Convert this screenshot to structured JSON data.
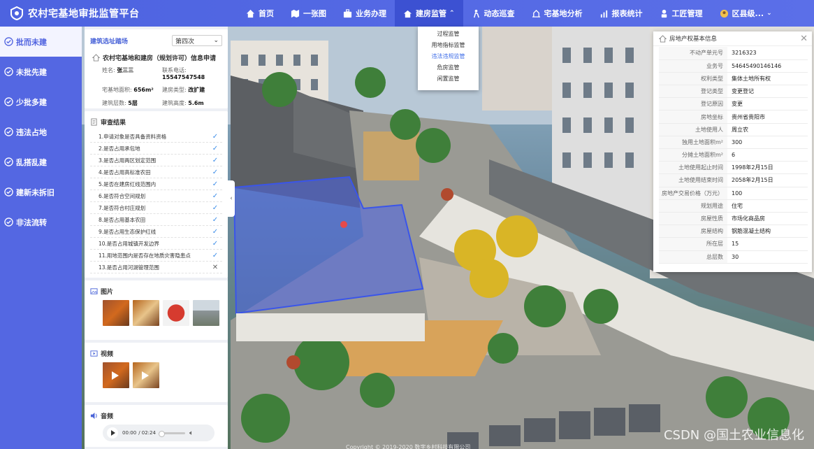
{
  "app": {
    "title": "农村宅基地审批监管平台"
  },
  "nav": [
    {
      "label": "首页",
      "icon": "home-icon"
    },
    {
      "label": "一张图",
      "icon": "map-icon"
    },
    {
      "label": "业务办理",
      "icon": "briefcase-icon"
    },
    {
      "label": "建房监管",
      "icon": "house-icon",
      "active": true
    },
    {
      "label": "动态巡查",
      "icon": "patrol-icon"
    },
    {
      "label": "宅基地分析",
      "icon": "analysis-icon"
    },
    {
      "label": "报表统计",
      "icon": "chart-icon"
    },
    {
      "label": "工匠管理",
      "icon": "worker-icon"
    },
    {
      "label": "区县级...",
      "icon": "avatar-icon"
    }
  ],
  "dropdown": [
    "过程监管",
    "用地指标监管",
    "违法违规监管",
    "危房监管",
    "闲置监管"
  ],
  "sidebar": [
    "批而未建",
    "未批先建",
    "少批多建",
    "违法占地",
    "乱搭乱建",
    "建新未拆旧",
    "非法流转"
  ],
  "panel": {
    "site_label": "建筑选址踏场",
    "round_select": "第四次",
    "app_title": "农村宅基地和建房（规划许可）信息申请",
    "fields": [
      {
        "k": "姓名:",
        "v": "张三三"
      },
      {
        "k": "联系电话:",
        "v": "15547547548"
      },
      {
        "k": "宅基地面积:",
        "v": "656m²"
      },
      {
        "k": "建房类型:",
        "v": "改扩建"
      },
      {
        "k": "建筑层数:",
        "v": "5层"
      },
      {
        "k": "建筑高度:",
        "v": "5.6m"
      }
    ],
    "review_title": "审查结果",
    "checks": [
      {
        "text": "1.申请对象是否具备资料资格",
        "ok": true
      },
      {
        "text": "2.是否占用承包地",
        "ok": true
      },
      {
        "text": "3.是否占用两区划定范围",
        "ok": true
      },
      {
        "text": "4.是否占用高标准农田",
        "ok": true
      },
      {
        "text": "5.是否在建房红线范围内",
        "ok": true
      },
      {
        "text": "6.是否符合空间规划",
        "ok": true
      },
      {
        "text": "7.是否符合村庄规划",
        "ok": true
      },
      {
        "text": "8.是否占用基本农田",
        "ok": true
      },
      {
        "text": "9.是否占用生态保护红线",
        "ok": true
      },
      {
        "text": "10.是否占用城镇开发边界",
        "ok": true
      },
      {
        "text": "11.用地范围内是否存在地质灾害隐患点",
        "ok": true
      },
      {
        "text": "13.是否占用河湖管理范围",
        "ok": false
      }
    ],
    "pictures_title": "图片",
    "video_title": "视频",
    "audio_title": "音频",
    "audio_time": "00:00",
    "audio_total": "/ 02:24"
  },
  "property": {
    "title": "房地产权基本信息",
    "rows": [
      {
        "k": "不动产单元号",
        "v": "3216323"
      },
      {
        "k": "业务号",
        "v": "54645490146146"
      },
      {
        "k": "权利类型",
        "v": "集体土地所有权"
      },
      {
        "k": "登记类型",
        "v": "变更登记"
      },
      {
        "k": "登记原因",
        "v": "变更"
      },
      {
        "k": "房地坐标",
        "v": "贵州省贵阳市"
      },
      {
        "k": "土地使用人",
        "v": "周立农"
      },
      {
        "k": "独用土地面积m²",
        "v": "300"
      },
      {
        "k": "分摊土地面积m²",
        "v": "6"
      },
      {
        "k": "土地使用起止时间",
        "v": "1998年2月15日"
      },
      {
        "k": "土地使用结束时间",
        "v": "2058年2月15日"
      },
      {
        "k": "房地产交易价格（万元）",
        "v": "100"
      },
      {
        "k": "规划用途",
        "v": "住宅"
      },
      {
        "k": "房屋性质",
        "v": "市场化商品房"
      },
      {
        "k": "房屋结构",
        "v": "钢筋混凝土结构"
      },
      {
        "k": "所在层",
        "v": "15"
      },
      {
        "k": "总层数",
        "v": "30"
      }
    ]
  },
  "watermark": "CSDN @国土农业信息化",
  "copyright": "Copyright © 2019-2020 数字乡村科技有限公司"
}
